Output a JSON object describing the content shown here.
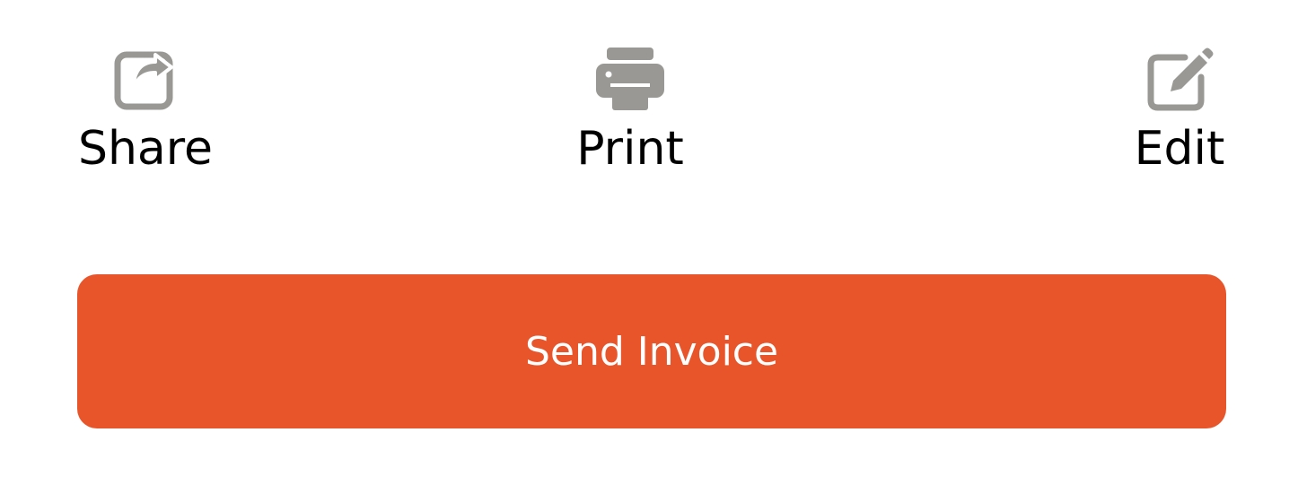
{
  "actions": {
    "share": {
      "label": "Share",
      "icon": "share-icon"
    },
    "print": {
      "label": "Print",
      "icon": "printer-icon"
    },
    "edit": {
      "label": "Edit",
      "icon": "edit-icon"
    }
  },
  "send_button": {
    "label": "Send Invoice"
  },
  "colors": {
    "accent": "#E9552B",
    "icon": "#999894",
    "label": "#000000",
    "button_text": "#FFFFFF"
  }
}
